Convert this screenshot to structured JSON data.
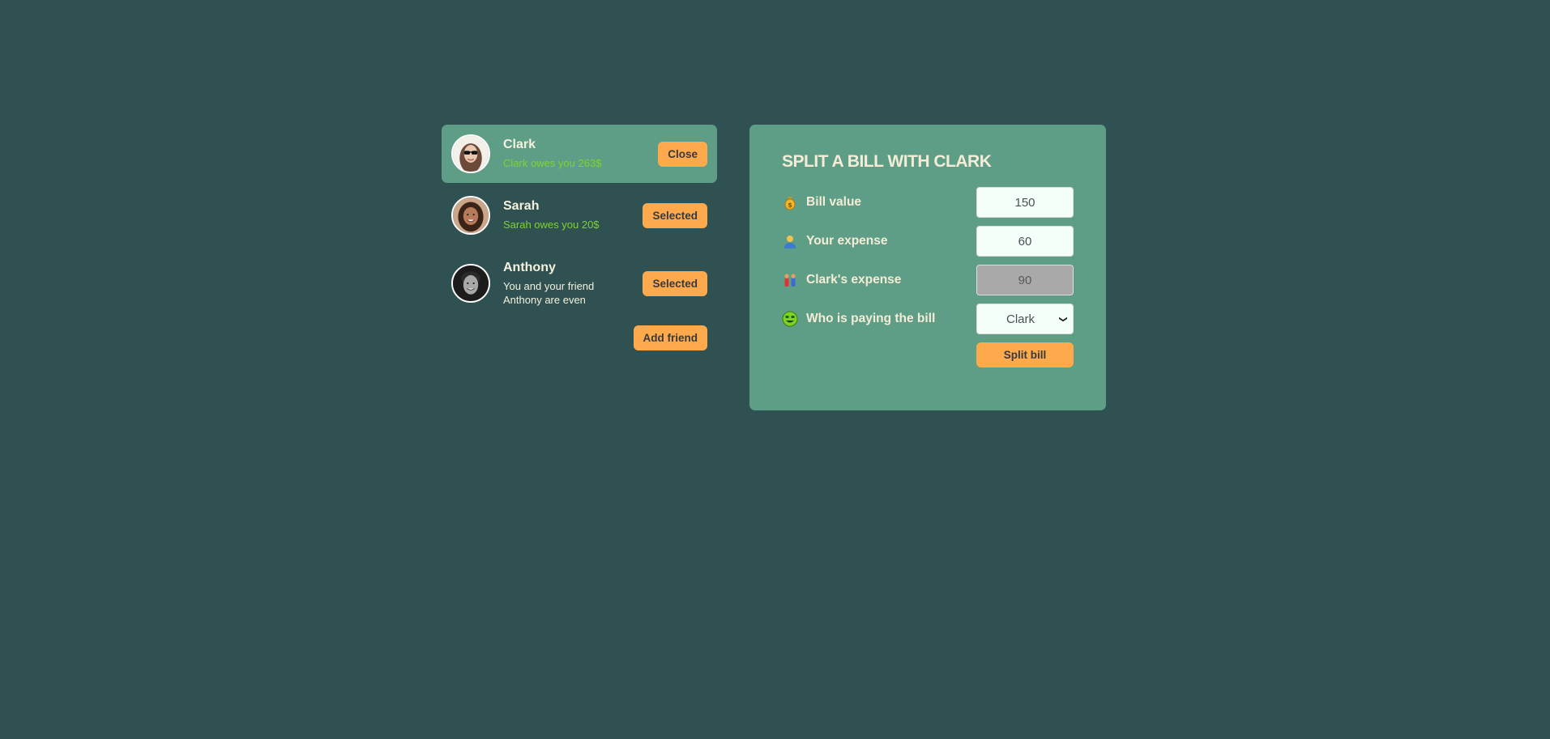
{
  "friends": [
    {
      "name": "Clark",
      "status": "Clark owes you 263$",
      "status_type": "owes",
      "button": "Close",
      "selected": true,
      "avatar_color": "#d9c3b0"
    },
    {
      "name": "Sarah",
      "status": "Sarah owes you 20$",
      "status_type": "owes",
      "button": "Selected",
      "selected": false,
      "avatar_color": "#7a4a35"
    },
    {
      "name": "Anthony",
      "status": "You and your friend Anthony are even",
      "status_type": "even",
      "button": "Selected",
      "selected": false,
      "avatar_color": "#333333"
    }
  ],
  "sidebar": {
    "add_friend_label": "Add friend"
  },
  "form": {
    "title": "SPLIT A BILL WITH CLARK",
    "bill_label": "Bill value",
    "bill_value": "150",
    "expense_label": "Your expense",
    "expense_value": "60",
    "friend_expense_label": "Clark's expense",
    "friend_expense_value": "90",
    "payer_label": "Who is paying the bill",
    "payer_value": "Clark",
    "submit_label": "Split bill"
  },
  "colors": {
    "background": "#2f5151",
    "panel": "#5f9e86",
    "accent": "#ffa94d",
    "owes_text": "#7dd330"
  }
}
